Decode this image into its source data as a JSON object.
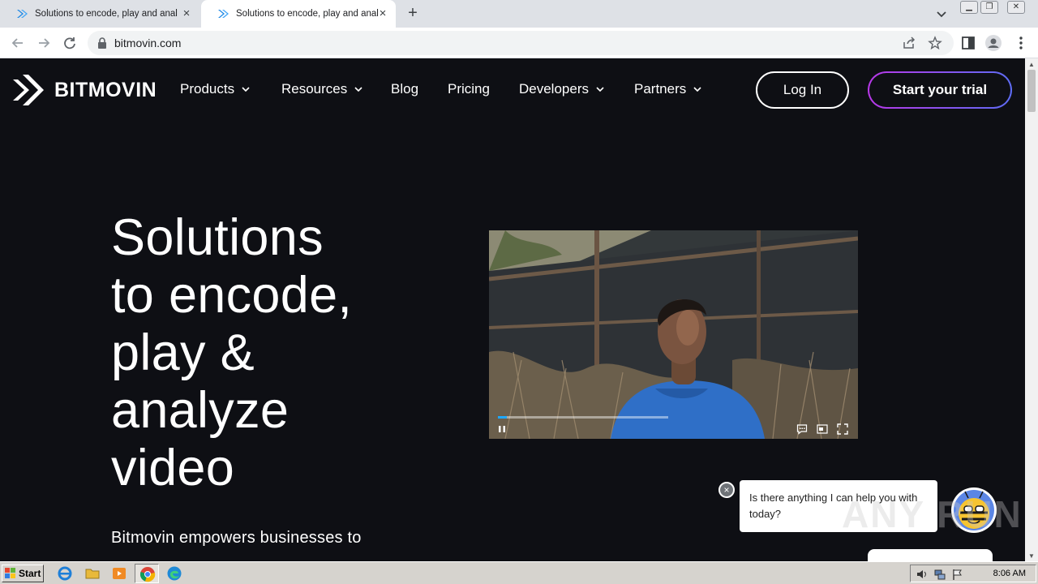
{
  "browser": {
    "tabs": [
      {
        "title": "Solutions to encode, play and analyze video",
        "active": false
      },
      {
        "title": "Solutions to encode, play and analyze video",
        "active": true
      }
    ],
    "new_tab_label": "+",
    "url": "bitmovin.com"
  },
  "site": {
    "logo_text": "BITMOVIN",
    "nav": [
      {
        "label": "Products",
        "has_dropdown": true
      },
      {
        "label": "Resources",
        "has_dropdown": true
      },
      {
        "label": "Blog",
        "has_dropdown": false
      },
      {
        "label": "Pricing",
        "has_dropdown": false
      },
      {
        "label": "Developers",
        "has_dropdown": true
      },
      {
        "label": "Partners",
        "has_dropdown": true
      }
    ],
    "login_label": "Log In",
    "trial_label": "Start your trial"
  },
  "hero": {
    "title_lines": [
      "Solutions",
      "to encode,",
      "play &",
      "analyze",
      "video"
    ],
    "description": "Bitmovin empowers businesses to"
  },
  "video": {
    "progress": 0.05,
    "buffer": 0.46,
    "controls": [
      "pause-icon",
      "subtitles-icon",
      "picture-in-picture-icon",
      "fullscreen-icon"
    ]
  },
  "chat": {
    "message": "Is there anything I can help you with today?",
    "close_label": "×"
  },
  "watermark": "ANY RUN",
  "taskbar": {
    "start_label": "Start",
    "time": "8:06 AM"
  },
  "colors": {
    "page_bg": "#0e0f14",
    "accent_gradient_start": "#b838e8",
    "accent_gradient_end": "#5e6cf5",
    "progress": "#1fa8ff"
  }
}
